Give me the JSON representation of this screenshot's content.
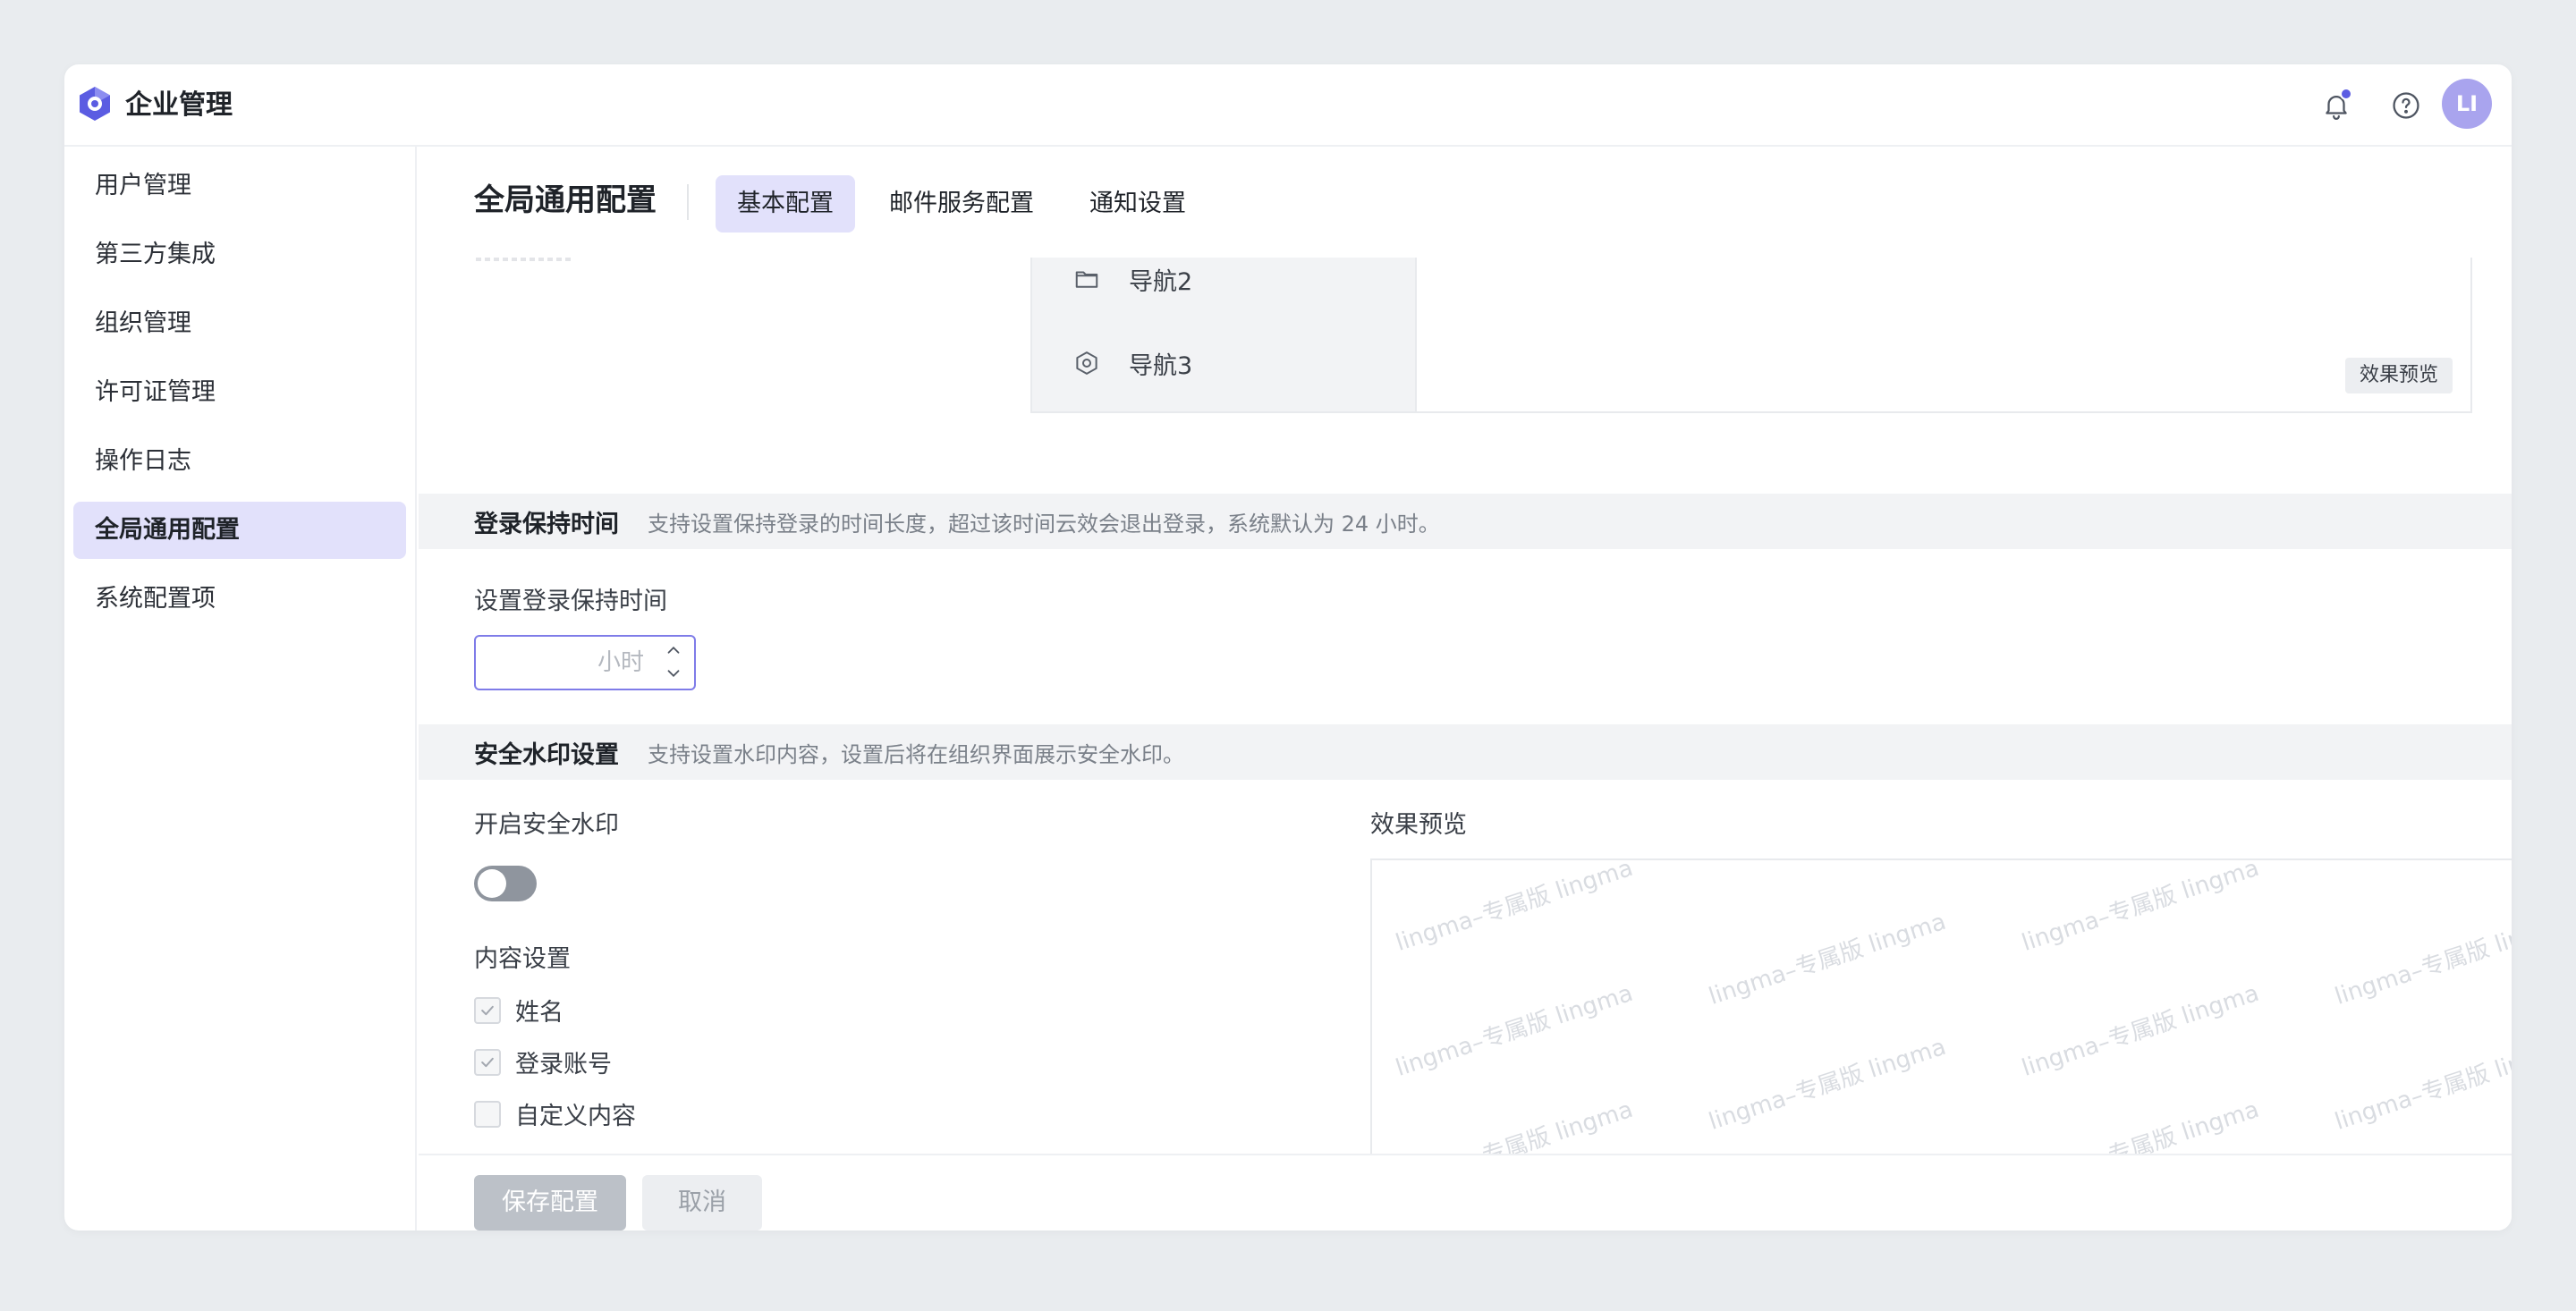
{
  "app": {
    "title": "企业管理",
    "avatar_initials": "LI",
    "accent": "#5b5ce2"
  },
  "topbar": {
    "icons": [
      "bell-icon",
      "help-icon"
    ]
  },
  "sidebar": {
    "items": [
      {
        "label": "用户管理",
        "active": false
      },
      {
        "label": "第三方集成",
        "active": false
      },
      {
        "label": "组织管理",
        "active": false
      },
      {
        "label": "许可证管理",
        "active": false
      },
      {
        "label": "操作日志",
        "active": false
      },
      {
        "label": "全局通用配置",
        "active": true
      },
      {
        "label": "系统配置项",
        "active": false
      }
    ]
  },
  "page": {
    "title": "全局通用配置",
    "tabs": [
      {
        "label": "基本配置",
        "active": true
      },
      {
        "label": "邮件服务配置",
        "active": false
      },
      {
        "label": "通知设置",
        "active": false
      }
    ]
  },
  "nav_preview": {
    "items": [
      {
        "label": "导航2",
        "icon": "folder-icon"
      },
      {
        "label": "导航3",
        "icon": "hexagon-icon"
      }
    ],
    "tag": "效果预览"
  },
  "login_session": {
    "title": "登录保持时间",
    "desc": "支持设置保持登录的时间长度，超过该时间云效会退出登录，系统默认为 24 小时。",
    "field_label": "设置登录保持时间",
    "input_value": "",
    "input_placeholder": "小时"
  },
  "watermark": {
    "title": "安全水印设置",
    "desc": "支持设置水印内容，设置后将在组织界面展示安全水印。",
    "enable_label": "开启安全水印",
    "enabled": false,
    "content_label": "内容设置",
    "options": [
      {
        "label": "姓名",
        "checked": true
      },
      {
        "label": "登录账号",
        "checked": true
      },
      {
        "label": "自定义内容",
        "checked": false
      }
    ],
    "preview_label": "效果预览",
    "sample_text": "lingma–专属版 lingma"
  },
  "footer": {
    "save_label": "保存配置",
    "cancel_label": "取消"
  }
}
